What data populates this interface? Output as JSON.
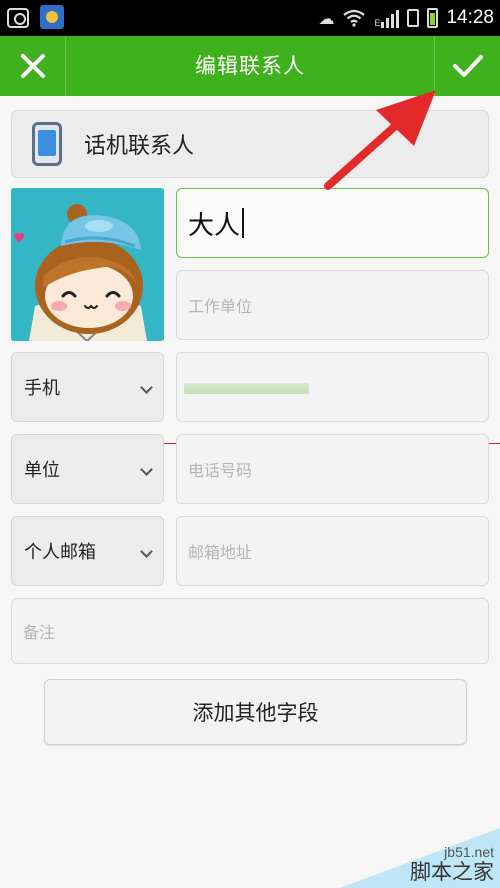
{
  "statusbar": {
    "time": "14:28",
    "network": "E"
  },
  "header": {
    "title": "编辑联系人",
    "close_icon": "close-icon",
    "confirm_icon": "checkmark-icon",
    "background": "#3fb11c"
  },
  "account": {
    "label": "话机联系人",
    "icon": "phone-icon"
  },
  "name": {
    "value": "大人"
  },
  "company": {
    "placeholder": "工作单位"
  },
  "phone": {
    "type_label": "手机"
  },
  "office": {
    "type_label": "单位",
    "placeholder": "电话号码"
  },
  "email": {
    "type_label": "个人邮箱",
    "placeholder": "邮箱地址"
  },
  "note": {
    "placeholder": "备注"
  },
  "add_field_button": "添加其他字段",
  "watermark": {
    "site": "jb51.net",
    "name": "脚本之家"
  }
}
